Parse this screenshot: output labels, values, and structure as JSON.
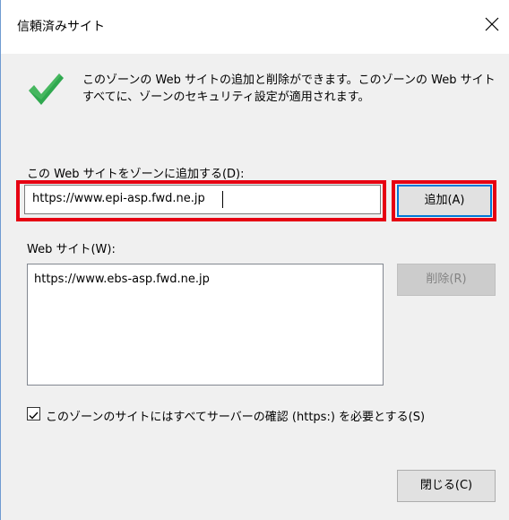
{
  "dialog": {
    "title": "信頼済みサイト",
    "close_icon": "close-icon",
    "description_line1": "このゾーンの Web サイトの追加と削除ができます。このゾーンの Web サイト",
    "description_line2": "すべてに、ゾーンのセキュリティ設定が適用されます。",
    "status_icon": "checkmark-icon",
    "accent_color": "#0078d7",
    "highlight_color": "#e60012"
  },
  "add_section": {
    "label": "この Web サイトをゾーンに追加する(D):",
    "input_value": "https://www.epi-asp.fwd.ne.jp",
    "add_button": "追加(A)"
  },
  "sites_section": {
    "label": "Web サイト(W):",
    "sites": [
      "https://www.ebs-asp.fwd.ne.jp"
    ],
    "remove_button": "削除(R)"
  },
  "options": {
    "require_https_checked": true,
    "require_https_label": "このゾーンのサイトにはすべてサーバーの確認 (https:) を必要とする(S)"
  },
  "footer": {
    "close_button": "閉じる(C)"
  }
}
